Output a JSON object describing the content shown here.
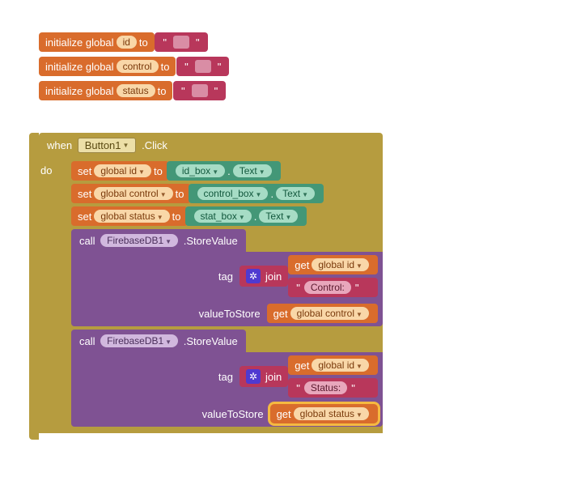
{
  "init": [
    {
      "kw": "initialize global",
      "var": "id",
      "to": "to",
      "val": ""
    },
    {
      "kw": "initialize global",
      "var": "control",
      "to": "to",
      "val": ""
    },
    {
      "kw": "initialize global",
      "var": "status",
      "to": "to",
      "val": ""
    }
  ],
  "event": {
    "when": "when",
    "component": "Button1",
    "evt": ".Click",
    "do": "do"
  },
  "sets": [
    {
      "set": "set",
      "var": "global id",
      "to": "to",
      "box": "id_box",
      "dot": ".",
      "prop": "Text"
    },
    {
      "set": "set",
      "var": "global control",
      "to": "to",
      "box": "control_box",
      "dot": ".",
      "prop": "Text"
    },
    {
      "set": "set",
      "var": "global status",
      "to": "to",
      "box": "stat_box",
      "dot": ".",
      "prop": "Text"
    }
  ],
  "calls": [
    {
      "call": "call",
      "component": "FirebaseDB1",
      "method": ".StoreValue",
      "args": {
        "tagLabel": "tag",
        "tag": {
          "join": "join",
          "parts": [
            {
              "type": "get",
              "get": "get",
              "var": "global id"
            },
            {
              "type": "str",
              "val": "Control:"
            }
          ]
        },
        "valLabel": "valueToStore",
        "val": {
          "get": "get",
          "var": "global control"
        }
      }
    },
    {
      "call": "call",
      "component": "FirebaseDB1",
      "method": ".StoreValue",
      "args": {
        "tagLabel": "tag",
        "tag": {
          "join": "join",
          "parts": [
            {
              "type": "get",
              "get": "get",
              "var": "global id"
            },
            {
              "type": "str",
              "val": "Status:"
            }
          ]
        },
        "valLabel": "valueToStore",
        "val": {
          "get": "get",
          "var": "global status",
          "highlight": true
        }
      }
    }
  ],
  "colors": {
    "orange": "#d96c2c",
    "magenta": "#b8375b",
    "olive": "#b69c3f",
    "green": "#439777",
    "purple": "#7f5293"
  }
}
